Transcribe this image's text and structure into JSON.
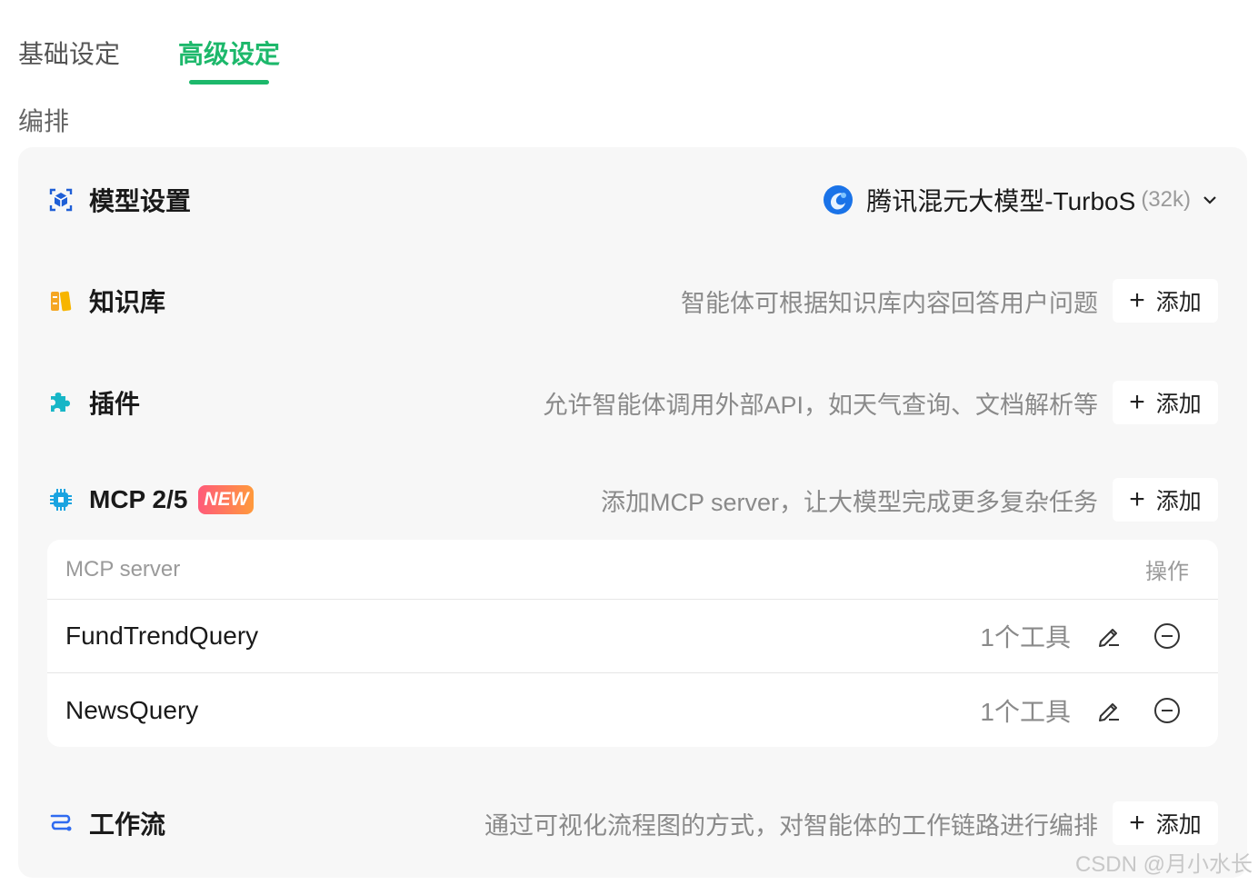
{
  "tabs": {
    "basic": "基础设定",
    "advanced": "高级设定"
  },
  "section_label": "编排",
  "model": {
    "title": "模型设置",
    "name": "腾讯混元大模型-TurboS",
    "context": "(32k)"
  },
  "knowledge": {
    "title": "知识库",
    "desc": "智能体可根据知识库内容回答用户问题",
    "add_label": "添加"
  },
  "plugins": {
    "title": "插件",
    "desc": "允许智能体调用外部API，如天气查询、文档解析等",
    "add_label": "添加"
  },
  "mcp": {
    "title": "MCP 2/5",
    "badge": "NEW",
    "desc": "添加MCP server，让大模型完成更多复杂任务",
    "add_label": "添加",
    "table": {
      "col_server": "MCP server",
      "col_action": "操作",
      "rows": [
        {
          "name": "FundTrendQuery",
          "tools": "1个工具"
        },
        {
          "name": "NewsQuery",
          "tools": "1个工具"
        }
      ]
    }
  },
  "workflow": {
    "title": "工作流",
    "desc": "通过可视化流程图的方式，对智能体的工作链路进行编排",
    "add_label": "添加"
  },
  "watermark": "CSDN @月小水长",
  "colors": {
    "accent": "#1db86b",
    "panel_bg": "#f7f7f7",
    "badge_start": "#ff5a7a",
    "badge_end": "#ff9a3c"
  },
  "icons": {
    "model": "cube-icon",
    "knowledge": "books-icon",
    "plugins": "puzzle-icon",
    "mcp": "chip-icon",
    "workflow": "flow-icon",
    "model_logo": "hunyuan-logo-icon",
    "edit": "pencil-icon",
    "remove": "minus-circle-icon",
    "dropdown": "chevron-down-icon",
    "add": "plus-icon"
  }
}
